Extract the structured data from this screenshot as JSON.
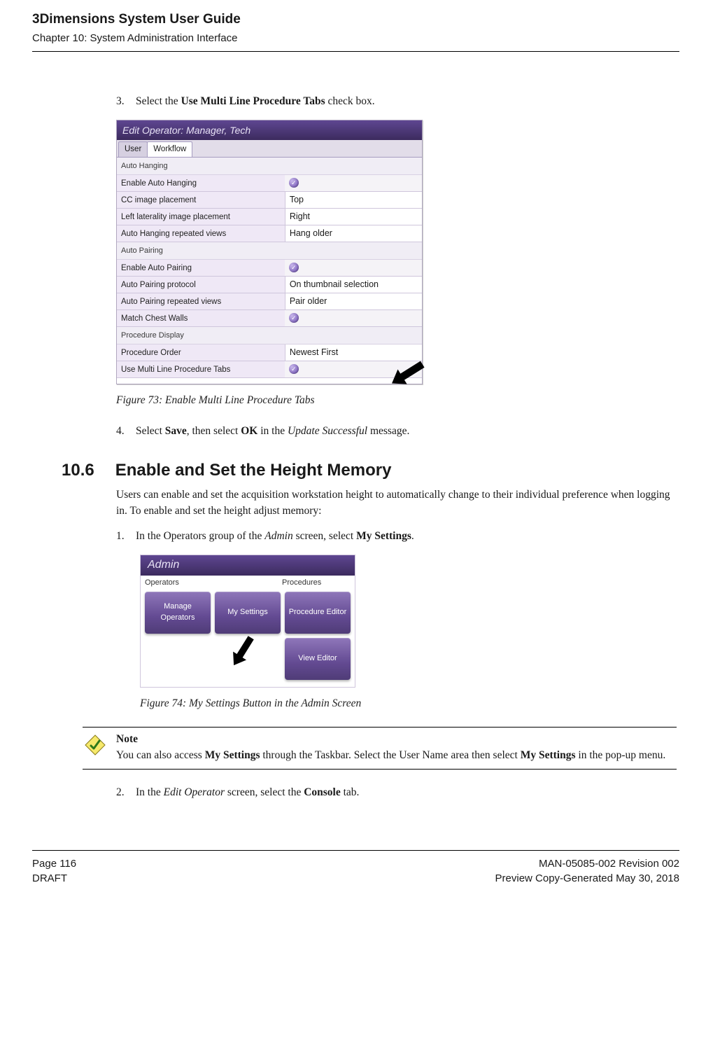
{
  "header": {
    "title": "3Dimensions System User Guide",
    "chapter": "Chapter 10: System Administration Interface"
  },
  "footer": {
    "left1": "Page 116",
    "left2": "DRAFT",
    "right1": "MAN-05085-002 Revision 002",
    "right2": "Preview Copy-Generated May 30, 2018"
  },
  "steps": {
    "s3_num": "3.",
    "s3_prefix": "Select the ",
    "s3_bold": "Use Multi Line Procedure Tabs",
    "s3_suffix": " check box.",
    "s4_num": "4.",
    "s4_prefix": "Select ",
    "s4_b1": "Save",
    "s4_mid1": ", then select ",
    "s4_b2": "OK",
    "s4_mid2": " in the ",
    "s4_em": "Update Successful",
    "s4_suffix": " message.",
    "s1b_num": "1.",
    "s1b_prefix": "In the Operators group of the ",
    "s1b_em": "Admin",
    "s1b_mid": " screen, select ",
    "s1b_bold": "My Settings",
    "s1b_suffix": ".",
    "s2b_num": "2.",
    "s2b_prefix": "In the ",
    "s2b_em": "Edit Operator",
    "s2b_mid": " screen, select the ",
    "s2b_bold": "Console",
    "s2b_suffix": " tab."
  },
  "captions": {
    "fig73": "Figure 73: Enable Multi Line Procedure Tabs",
    "fig74": "Figure 74: My Settings Button in the Admin Screen"
  },
  "section": {
    "no": "10.6",
    "title": "Enable and Set the Height Memory",
    "para": "Users can enable and set the acquisition workstation height to automatically change to their individual preference when logging in. To enable and set the height adjust memory:"
  },
  "editop": {
    "title": "Edit Operator: Manager, Tech",
    "tab_user": "User",
    "tab_workflow": "Workflow",
    "grp_hanging": "Auto Hanging",
    "r1": "Enable Auto Hanging",
    "r2": "CC image placement",
    "r2v": "Top",
    "r3": "Left laterality image placement",
    "r3v": "Right",
    "r4": "Auto Hanging repeated views",
    "r4v": "Hang older",
    "grp_pairing": "Auto Pairing",
    "r5": "Enable Auto Pairing",
    "r6": "Auto Pairing protocol",
    "r6v": "On thumbnail selection",
    "r7": "Auto Pairing repeated views",
    "r7v": "Pair older",
    "r8": "Match Chest Walls",
    "grp_proc": "Procedure Display",
    "r9": "Procedure Order",
    "r9v": "Newest First",
    "r10": "Use Multi Line Procedure Tabs"
  },
  "admin": {
    "title": "Admin",
    "head_ops": "Operators",
    "head_proc": "Procedures",
    "tile_manage": "Manage\nOperators",
    "tile_settings": "My Settings",
    "tile_proc": "Procedure\nEditor",
    "tile_view": "View Editor"
  },
  "note": {
    "head": "Note",
    "l1a": "You can also access ",
    "l1b": "My Settings",
    "l1c": " through the Taskbar. Select the User Name area then select ",
    "l1d": "My Settings",
    "l1e": " in the pop-up menu."
  }
}
